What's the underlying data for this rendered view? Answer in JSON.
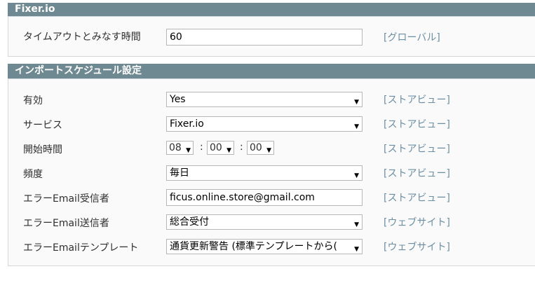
{
  "fixer": {
    "header": "Fixer.io",
    "timeout_label": "タイムアウトとみなす時間",
    "timeout_value": "60",
    "timeout_scope": "[グローバル]"
  },
  "schedule": {
    "header": "インポートスケジュール設定",
    "rows": [
      {
        "label": "有効",
        "value": "Yes",
        "scope": "[ストアビュー]"
      },
      {
        "label": "サービス",
        "value": "Fixer.io",
        "scope": "[ストアビュー]"
      },
      {
        "label": "開始時間",
        "hour": "08",
        "minute": "00",
        "second": "00",
        "scope": "[ストアビュー]"
      },
      {
        "label": "頻度",
        "value": "毎日",
        "scope": "[ストアビュー]"
      },
      {
        "label": "エラーEmail受信者",
        "value": "ficus.online.store@gmail.com",
        "scope": "[ストアビュー]"
      },
      {
        "label": "エラーEmail送信者",
        "value": "総合受付",
        "scope": "[ウェブサイト]"
      },
      {
        "label": "エラーEmailテンプレート",
        "value": "通貨更新警告 (標準テンプレートから(",
        "scope": "[ウェブサイト]"
      }
    ]
  },
  "icons": {
    "dropdown": "chevron-down-icon",
    "arrow_glyph": "▼"
  },
  "colors": {
    "header_bg": "#6f8992",
    "scope_text": "#6b8ea4"
  }
}
